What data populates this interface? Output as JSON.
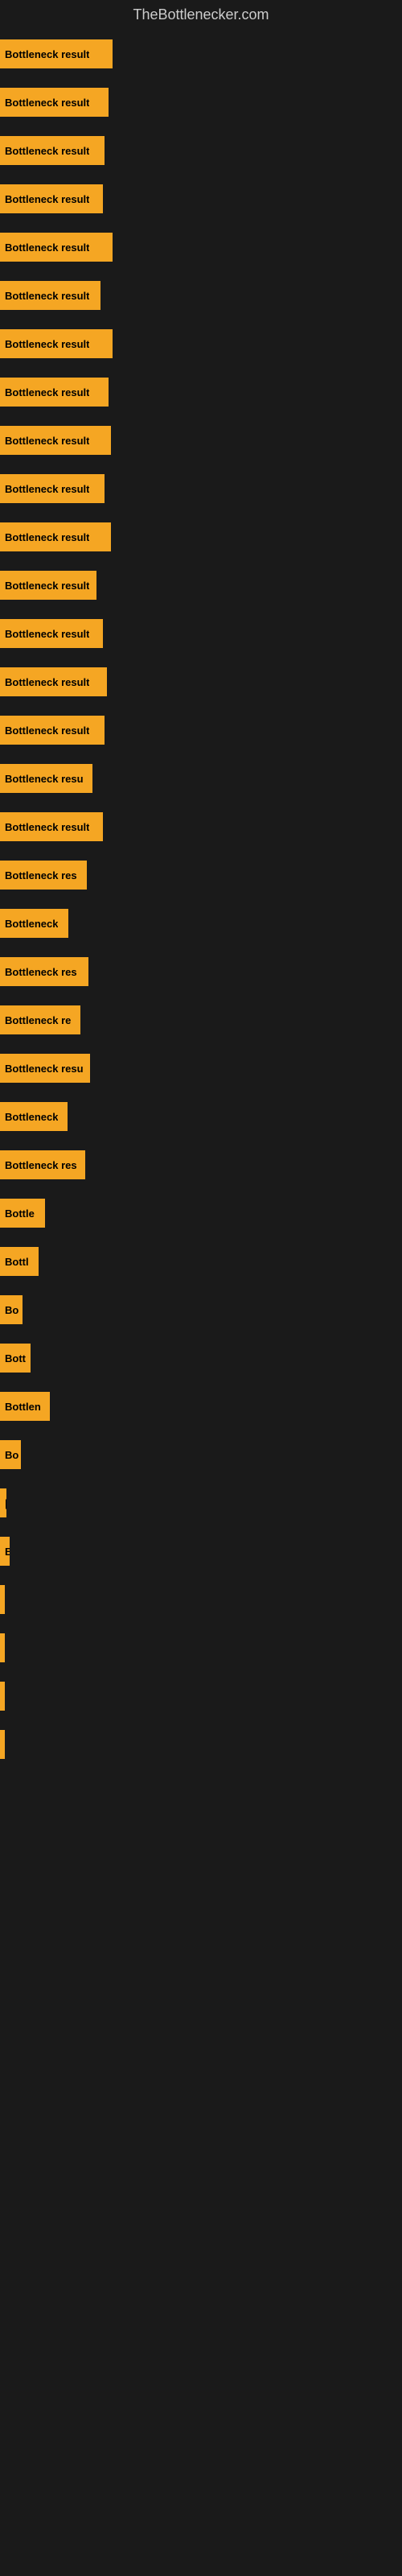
{
  "site": {
    "title": "TheBottlenecker.com"
  },
  "bars": [
    {
      "label": "Bottleneck result",
      "width": 140
    },
    {
      "label": "Bottleneck result",
      "width": 135
    },
    {
      "label": "Bottleneck result",
      "width": 130
    },
    {
      "label": "Bottleneck result",
      "width": 128
    },
    {
      "label": "Bottleneck result",
      "width": 140
    },
    {
      "label": "Bottleneck result",
      "width": 125
    },
    {
      "label": "Bottleneck result",
      "width": 140
    },
    {
      "label": "Bottleneck result",
      "width": 135
    },
    {
      "label": "Bottleneck result",
      "width": 138
    },
    {
      "label": "Bottleneck result",
      "width": 130
    },
    {
      "label": "Bottleneck result",
      "width": 138
    },
    {
      "label": "Bottleneck result",
      "width": 120
    },
    {
      "label": "Bottleneck result",
      "width": 128
    },
    {
      "label": "Bottleneck result",
      "width": 133
    },
    {
      "label": "Bottleneck result",
      "width": 130
    },
    {
      "label": "Bottleneck resu",
      "width": 115
    },
    {
      "label": "Bottleneck result",
      "width": 128
    },
    {
      "label": "Bottleneck res",
      "width": 108
    },
    {
      "label": "Bottleneck",
      "width": 85
    },
    {
      "label": "Bottleneck res",
      "width": 110
    },
    {
      "label": "Bottleneck re",
      "width": 100
    },
    {
      "label": "Bottleneck resu",
      "width": 112
    },
    {
      "label": "Bottleneck",
      "width": 84
    },
    {
      "label": "Bottleneck res",
      "width": 106
    },
    {
      "label": "Bottle",
      "width": 56
    },
    {
      "label": "Bottl",
      "width": 48
    },
    {
      "label": "Bo",
      "width": 28
    },
    {
      "label": "Bott",
      "width": 38
    },
    {
      "label": "Bottlen",
      "width": 62
    },
    {
      "label": "Bo",
      "width": 26
    },
    {
      "label": "|",
      "width": 8
    },
    {
      "label": "B",
      "width": 12
    },
    {
      "label": "|",
      "width": 6
    },
    {
      "label": "",
      "width": 4
    },
    {
      "label": "",
      "width": 4
    },
    {
      "label": "",
      "width": 4
    }
  ]
}
